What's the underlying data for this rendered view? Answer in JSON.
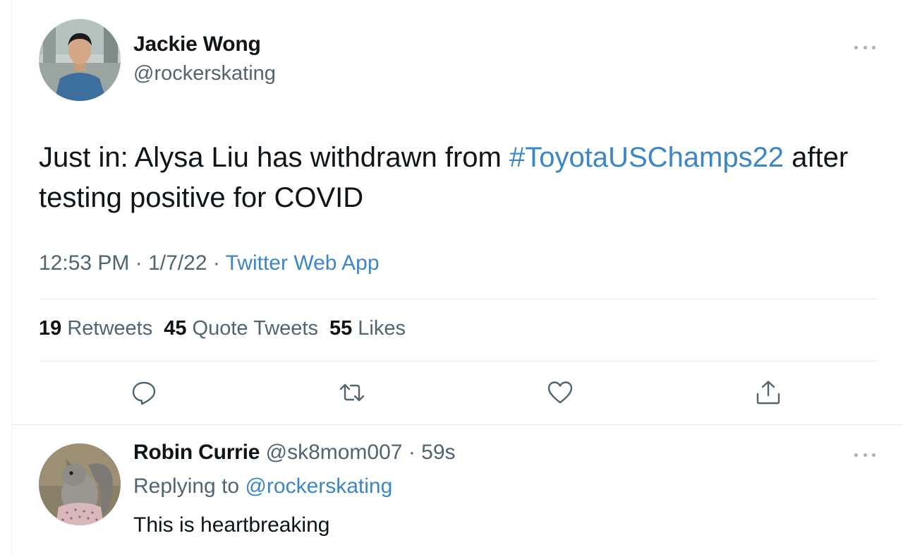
{
  "main_tweet": {
    "author": {
      "name": "Jackie Wong",
      "handle": "@rockerskating"
    },
    "text_before": "Just in: Alysa Liu has withdrawn from ",
    "hashtag": "#ToyotaUSChamps22",
    "text_after": " after testing positive for COVID",
    "meta": {
      "time": "12:53 PM",
      "sep1": " · ",
      "date": "1/7/22",
      "sep2": " · ",
      "source": "Twitter Web App"
    },
    "stats": {
      "retweets_count": "19",
      "retweets_label": " Retweets",
      "quotes_count": "45",
      "quotes_label": " Quote Tweets",
      "likes_count": "55",
      "likes_label": " Likes"
    },
    "actions": [
      "reply-icon",
      "retweet-icon",
      "like-icon",
      "share-icon"
    ],
    "more_icon": "more-icon"
  },
  "reply": {
    "name": "Robin Currie",
    "handle": " @sk8mom007",
    "sep": " · ",
    "time": "59s",
    "replying_prefix": "Replying to ",
    "replying_to": "@rockerskating",
    "text": "This is heartbreaking",
    "more_icon": "more-icon"
  },
  "colors": {
    "text": "#0f1419",
    "secondary": "#536471",
    "link": "#3b86c8",
    "divider": "#e4e8ea"
  }
}
